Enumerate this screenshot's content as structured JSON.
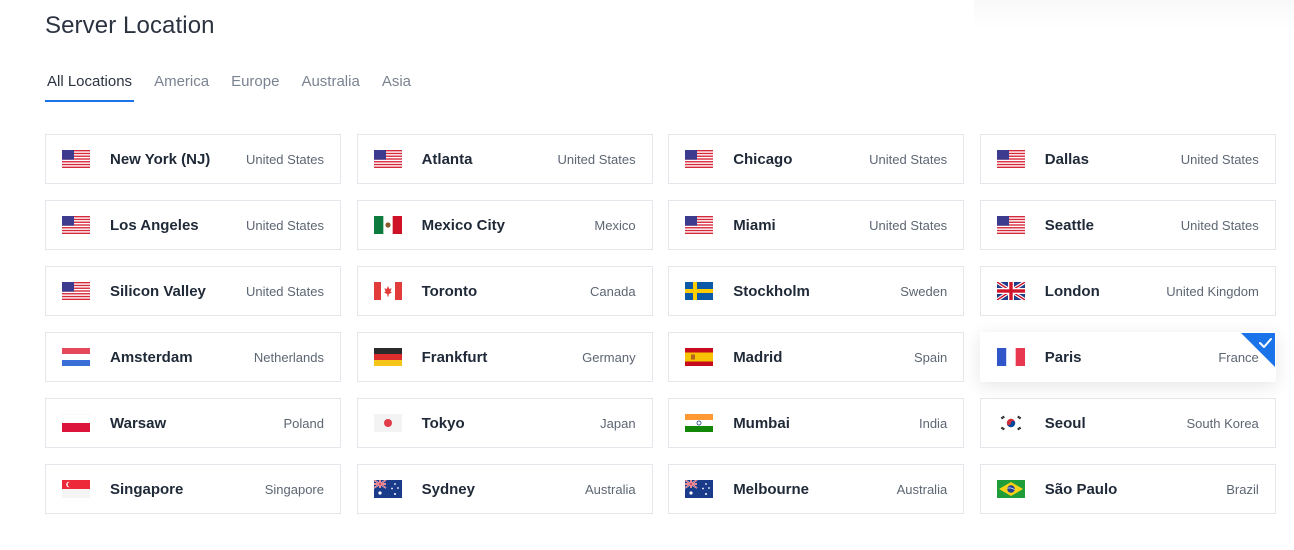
{
  "title": "Server Location",
  "tabs": [
    {
      "label": "All Locations",
      "active": true
    },
    {
      "label": "America"
    },
    {
      "label": "Europe"
    },
    {
      "label": "Australia"
    },
    {
      "label": "Asia"
    }
  ],
  "accent_color": "#1a73e8",
  "locations": [
    {
      "city": "New York (NJ)",
      "country": "United States",
      "flag": "us-flag-icon"
    },
    {
      "city": "Atlanta",
      "country": "United States",
      "flag": "us-flag-icon"
    },
    {
      "city": "Chicago",
      "country": "United States",
      "flag": "us-flag-icon"
    },
    {
      "city": "Dallas",
      "country": "United States",
      "flag": "us-flag-icon"
    },
    {
      "city": "Los Angeles",
      "country": "United States",
      "flag": "us-flag-icon"
    },
    {
      "city": "Mexico City",
      "country": "Mexico",
      "flag": "mexico-flag-icon"
    },
    {
      "city": "Miami",
      "country": "United States",
      "flag": "us-flag-icon"
    },
    {
      "city": "Seattle",
      "country": "United States",
      "flag": "us-flag-icon"
    },
    {
      "city": "Silicon Valley",
      "country": "United States",
      "flag": "us-flag-icon"
    },
    {
      "city": "Toronto",
      "country": "Canada",
      "flag": "canada-flag-icon"
    },
    {
      "city": "Stockholm",
      "country": "Sweden",
      "flag": "sweden-flag-icon"
    },
    {
      "city": "London",
      "country": "United Kingdom",
      "flag": "uk-flag-icon"
    },
    {
      "city": "Amsterdam",
      "country": "Netherlands",
      "flag": "netherlands-flag-icon"
    },
    {
      "city": "Frankfurt",
      "country": "Germany",
      "flag": "germany-flag-icon"
    },
    {
      "city": "Madrid",
      "country": "Spain",
      "flag": "spain-flag-icon"
    },
    {
      "city": "Paris",
      "country": "France",
      "flag": "france-flag-icon",
      "selected": true
    },
    {
      "city": "Warsaw",
      "country": "Poland",
      "flag": "poland-flag-icon"
    },
    {
      "city": "Tokyo",
      "country": "Japan",
      "flag": "japan-flag-icon"
    },
    {
      "city": "Mumbai",
      "country": "India",
      "flag": "india-flag-icon"
    },
    {
      "city": "Seoul",
      "country": "South Korea",
      "flag": "south-korea-flag-icon"
    },
    {
      "city": "Singapore",
      "country": "Singapore",
      "flag": "singapore-flag-icon"
    },
    {
      "city": "Sydney",
      "country": "Australia",
      "flag": "australia-flag-icon"
    },
    {
      "city": "Melbourne",
      "country": "Australia",
      "flag": "australia-flag-icon"
    },
    {
      "city": "São Paulo",
      "country": "Brazil",
      "flag": "brazil-flag-icon"
    }
  ]
}
